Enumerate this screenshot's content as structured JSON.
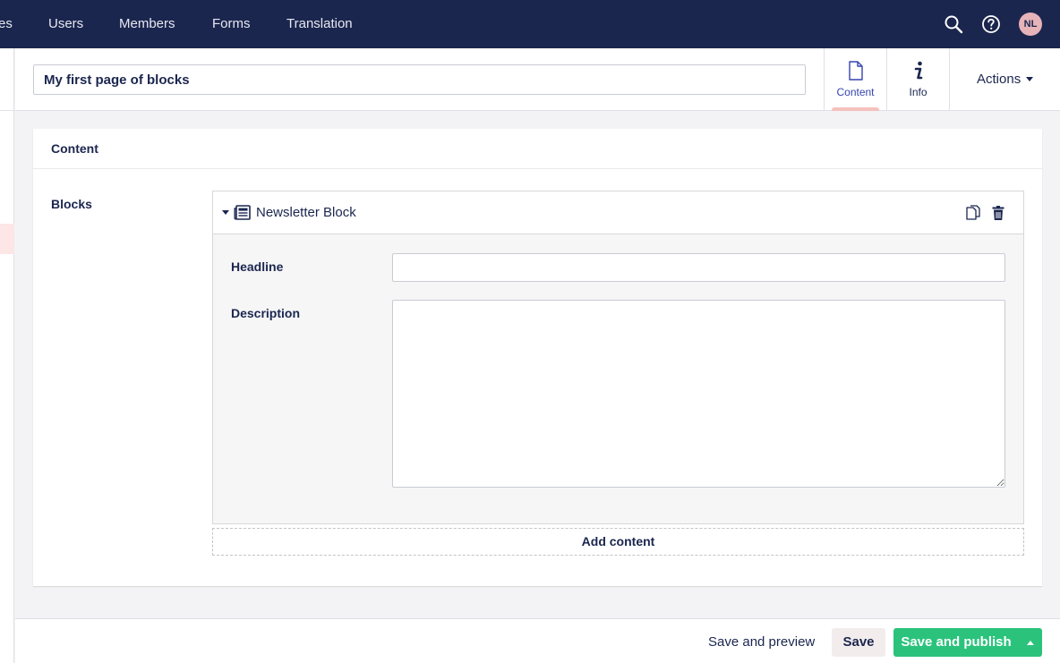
{
  "topnav": {
    "items": [
      "es",
      "Users",
      "Members",
      "Forms",
      "Translation"
    ],
    "icons": [
      "search-icon",
      "help-icon"
    ],
    "avatar_initials": "NL"
  },
  "editor": {
    "node_name": "My first page of blocks",
    "apps": [
      {
        "label": "Content",
        "icon": "document-icon",
        "active": true
      },
      {
        "label": "Info",
        "icon": "info-icon",
        "active": false
      }
    ],
    "actions_label": "Actions"
  },
  "panel": {
    "title": "Content",
    "property_label": "Blocks",
    "block": {
      "title": "Newsletter Block",
      "icon": "newspaper-icon",
      "actions": [
        "copy-icon",
        "delete-icon"
      ],
      "fields": [
        {
          "label": "Headline",
          "value": ""
        },
        {
          "label": "Description",
          "value": ""
        }
      ]
    },
    "add_content_label": "Add content"
  },
  "footer": {
    "save_preview_label": "Save and preview",
    "save_label": "Save",
    "publish_label": "Save and publish"
  },
  "colors": {
    "topbar": "#1b264f",
    "publish": "#2bc37c",
    "active_tab_indicator": "#f5c1bc",
    "active_tab_text": "#3544b1"
  }
}
